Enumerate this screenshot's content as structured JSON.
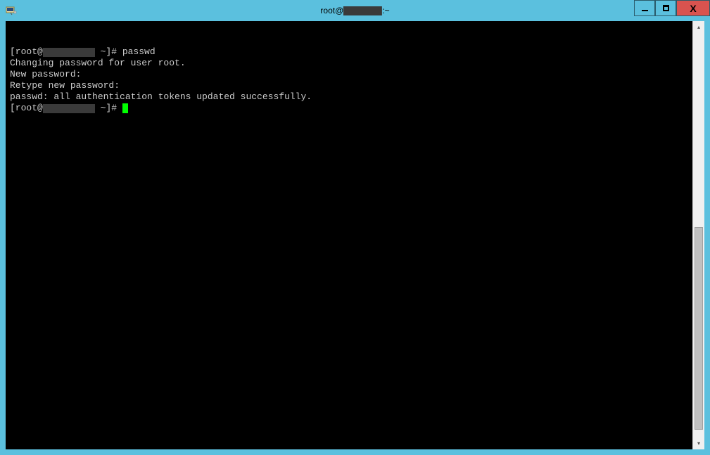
{
  "window": {
    "title_prefix": "root@",
    "title_suffix": ":~",
    "icon_name": "putty-icon"
  },
  "controls": {
    "minimize": "minimize",
    "maximize": "maximize",
    "close": "close"
  },
  "terminal": {
    "lines": [
      {
        "prefix": "[root@",
        "redact": true,
        "suffix": " ~]# ",
        "cmd": "passwd"
      },
      {
        "text": "Changing password for user root."
      },
      {
        "text": "New password:"
      },
      {
        "text": "Retype new password:"
      },
      {
        "text": "passwd: all authentication tokens updated successfully."
      },
      {
        "prefix": "[root@",
        "redact": true,
        "suffix": " ~]# ",
        "cursor": true
      }
    ]
  },
  "scrollbar": {
    "up_glyph": "▴",
    "down_glyph": "▾",
    "thumb_top_pct": 48,
    "thumb_height_pct": 50
  }
}
